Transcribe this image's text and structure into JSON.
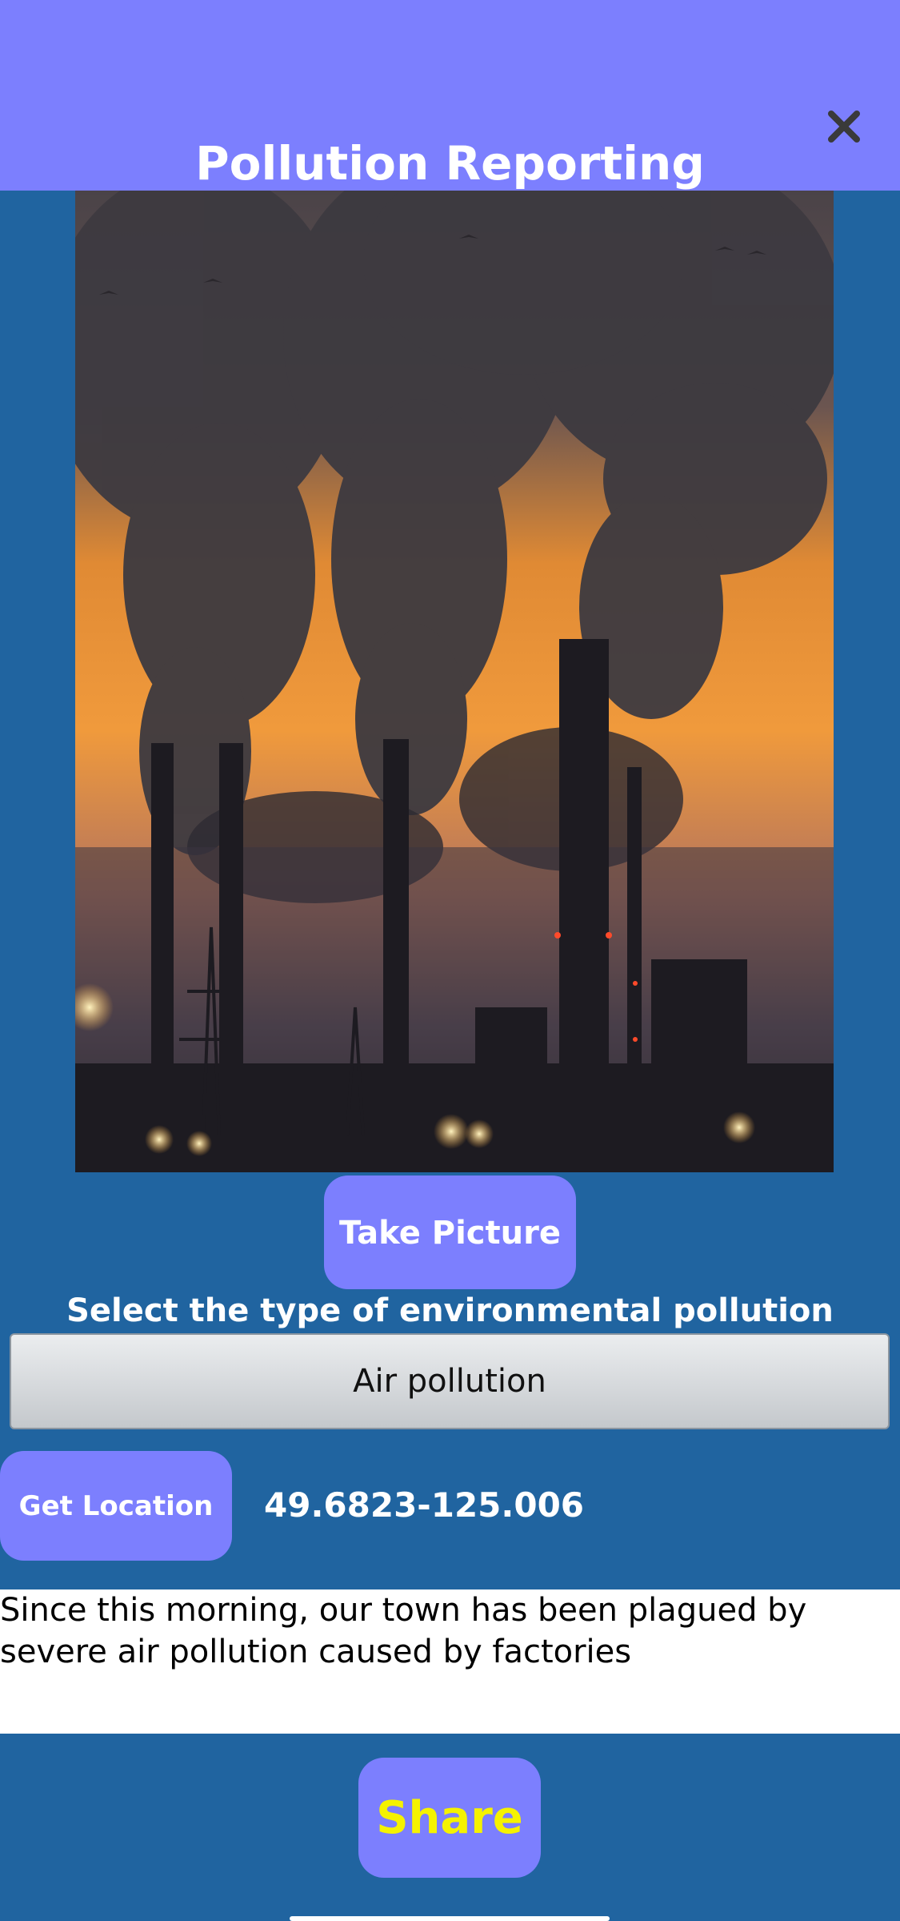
{
  "header": {
    "title": "Pollution Reporting",
    "close_icon": "close-icon",
    "background_color": "#7c7ffe"
  },
  "photo": {
    "subject": "factory-smokestacks-photo"
  },
  "actions": {
    "take_picture_label": "Take Picture",
    "get_location_label": "Get Location",
    "share_label": "Share"
  },
  "pollution_type": {
    "prompt": "Select the type of environmental pollution",
    "selected": "Air pollution"
  },
  "location": {
    "coordinates": "49.6823-125.006"
  },
  "description": {
    "text": "Since this morning, our town has been plagued by severe air pollution caused by factories"
  },
  "colors": {
    "background": "#2064a0",
    "button": "#7c7ffe",
    "share_text": "#f5f200"
  }
}
